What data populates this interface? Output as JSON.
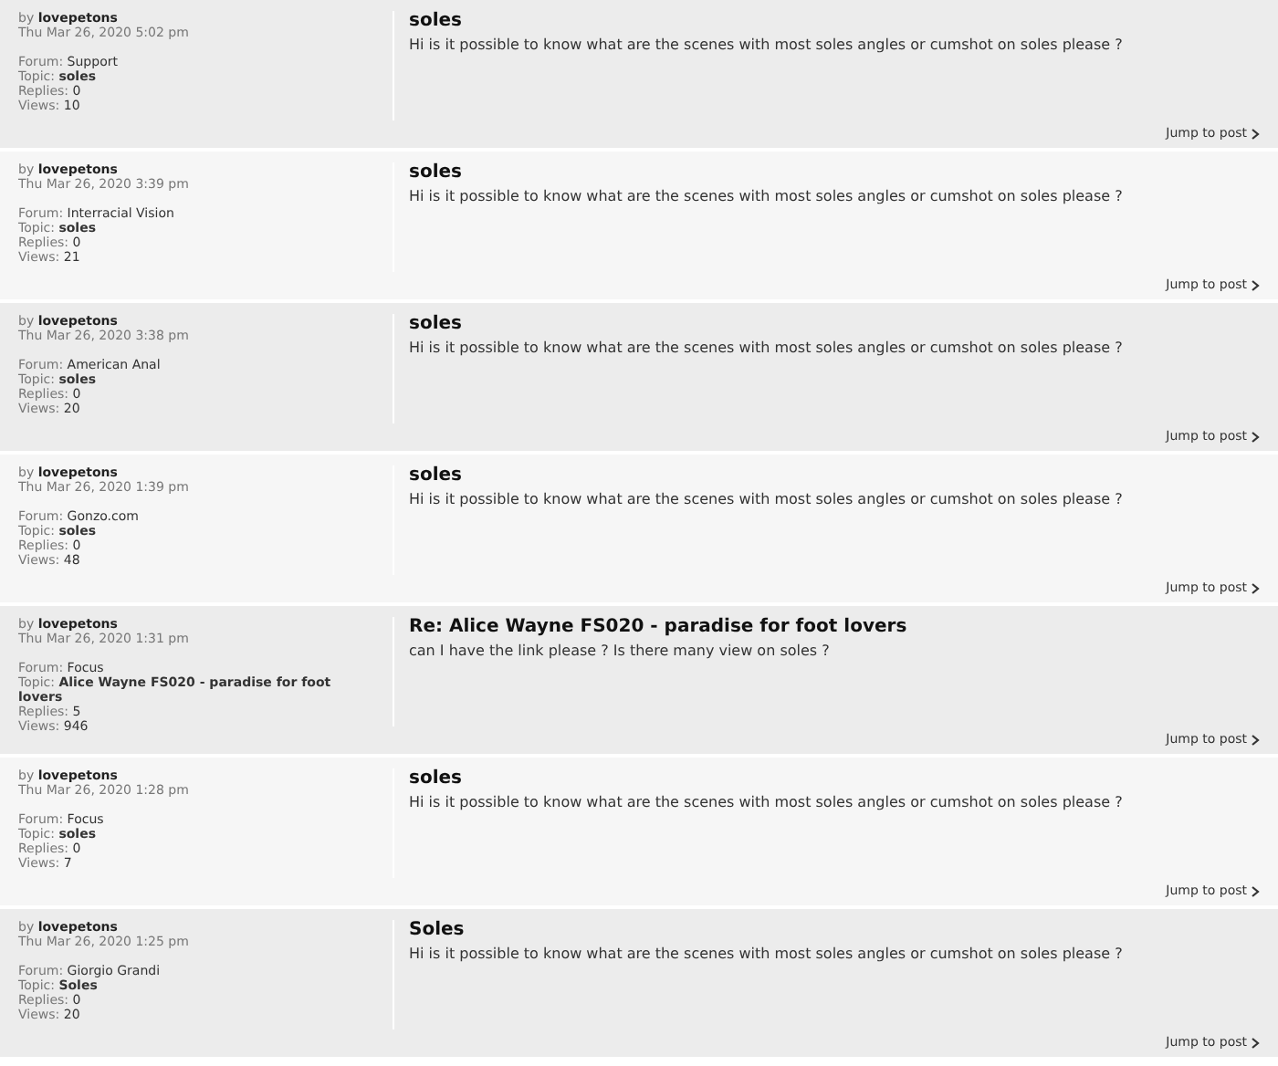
{
  "posts": [
    {
      "author_label": "by",
      "author": "lovepetons",
      "date": "Thu Mar 26, 2020 5:02 pm",
      "meta": [
        {
          "label": "Forum:",
          "value": "Support"
        },
        {
          "label": "Topic:",
          "value": "soles"
        },
        {
          "label": "Replies:",
          "value": "0"
        },
        {
          "label": "Views:",
          "value": "10"
        }
      ],
      "title": "soles",
      "body": "Hi is it possible to know what are the scenes with most soles angles or cumshot on soles please ?",
      "jump": "Jump to post"
    },
    {
      "author_label": "by",
      "author": "lovepetons",
      "date": "Thu Mar 26, 2020 3:39 pm",
      "meta": [
        {
          "label": "Forum:",
          "value": "Interracial Vision"
        },
        {
          "label": "Topic:",
          "value": "soles"
        },
        {
          "label": "Replies:",
          "value": "0"
        },
        {
          "label": "Views:",
          "value": "21"
        }
      ],
      "title": "soles",
      "body": "Hi is it possible to know what are the scenes with most soles angles or cumshot on soles please ?",
      "jump": "Jump to post"
    },
    {
      "author_label": "by",
      "author": "lovepetons",
      "date": "Thu Mar 26, 2020 3:38 pm",
      "meta": [
        {
          "label": "Forum:",
          "value": "American Anal"
        },
        {
          "label": "Topic:",
          "value": "soles"
        },
        {
          "label": "Replies:",
          "value": "0"
        },
        {
          "label": "Views:",
          "value": "20"
        }
      ],
      "title": "soles",
      "body": "Hi is it possible to know what are the scenes with most soles angles or cumshot on soles please ?",
      "jump": "Jump to post"
    },
    {
      "author_label": "by",
      "author": "lovepetons",
      "date": "Thu Mar 26, 2020 1:39 pm",
      "meta": [
        {
          "label": "Forum:",
          "value": "Gonzo.com"
        },
        {
          "label": "Topic:",
          "value": "soles"
        },
        {
          "label": "Replies:",
          "value": "0"
        },
        {
          "label": "Views:",
          "value": "48"
        }
      ],
      "title": "soles",
      "body": "Hi is it possible to know what are the scenes with most soles angles or cumshot on soles please ?",
      "jump": "Jump to post"
    },
    {
      "author_label": "by",
      "author": "lovepetons",
      "date": "Thu Mar 26, 2020 1:31 pm",
      "meta": [
        {
          "label": "Forum:",
          "value": "Focus"
        },
        {
          "label": "Topic:",
          "value": "Alice Wayne FS020 - paradise for foot lovers"
        },
        {
          "label": "Replies:",
          "value": "5"
        },
        {
          "label": "Views:",
          "value": "946"
        }
      ],
      "title": "Re: Alice Wayne FS020 - paradise for foot lovers",
      "body": "can I have the link please ? Is there many view on soles ?",
      "jump": "Jump to post"
    },
    {
      "author_label": "by",
      "author": "lovepetons",
      "date": "Thu Mar 26, 2020 1:28 pm",
      "meta": [
        {
          "label": "Forum:",
          "value": "Focus"
        },
        {
          "label": "Topic:",
          "value": "soles"
        },
        {
          "label": "Replies:",
          "value": "0"
        },
        {
          "label": "Views:",
          "value": "7"
        }
      ],
      "title": "soles",
      "body": "Hi is it possible to know what are the scenes with most soles angles or cumshot on soles please ?",
      "jump": "Jump to post"
    },
    {
      "author_label": "by",
      "author": "lovepetons",
      "date": "Thu Mar 26, 2020 1:25 pm",
      "meta": [
        {
          "label": "Forum:",
          "value": "Giorgio Grandi"
        },
        {
          "label": "Topic:",
          "value": "Soles"
        },
        {
          "label": "Replies:",
          "value": "0"
        },
        {
          "label": "Views:",
          "value": "20"
        }
      ],
      "title": "Soles",
      "body": "Hi is it possible to know what are the scenes with most soles angles or cumshot on soles please ?",
      "jump": "Jump to post"
    }
  ]
}
